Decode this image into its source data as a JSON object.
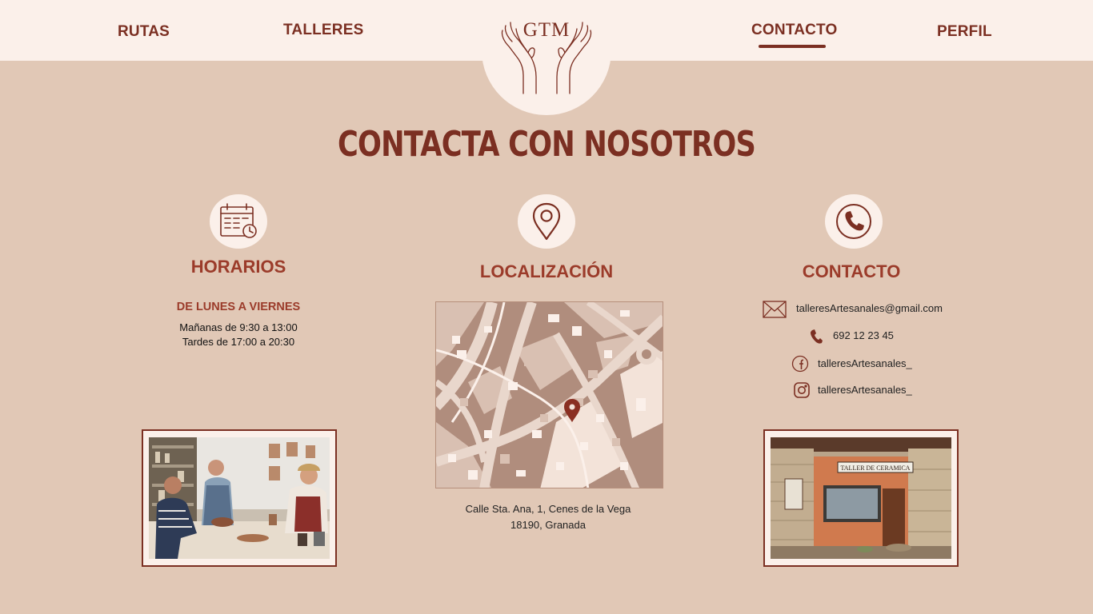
{
  "nav": {
    "items": [
      {
        "label": "RUTAS"
      },
      {
        "label": "TALLERES"
      },
      {
        "label": "CONTACTO",
        "active": true
      },
      {
        "label": "PERFIL"
      }
    ],
    "logo_text": "GTM"
  },
  "page_title": "CONTACTA CON NOSOTROS",
  "colors": {
    "background": "#e1c8b6",
    "nav_background": "#fbf0ea",
    "accent": "#7b2f22",
    "heading": "#9b3b2a"
  },
  "horarios": {
    "icon": "calendar-clock-icon",
    "title": "HORARIOS",
    "heading": "DE LUNES A VIERNES",
    "lines": [
      "Mañanas de 9:30 a 13:00",
      "Tardes de 17:00 a 20:30"
    ]
  },
  "localizacion": {
    "icon": "location-pin-icon",
    "title": "LOCALIZACIÓN",
    "address_line1": "Calle Sta. Ana, 1, Cenes de la Vega",
    "address_line2": "18190, Granada"
  },
  "contacto": {
    "icon": "phone-icon",
    "title": "CONTACTO",
    "email": "talleresArtesanales@gmail.com",
    "phone": "692 12 23 45",
    "facebook": "talleresArtesanales_",
    "instagram": "talleresArtesanales_"
  },
  "photos": {
    "right_sign": "TALLER DE CERAMICA"
  }
}
